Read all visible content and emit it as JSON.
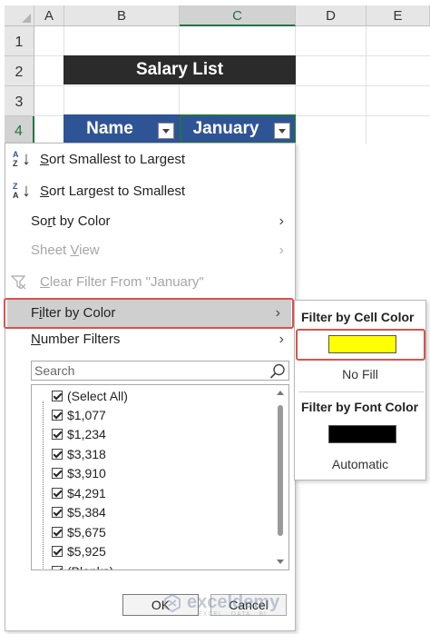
{
  "sheet": {
    "columns": [
      "A",
      "B",
      "C",
      "D",
      "E"
    ],
    "rows": [
      "1",
      "2",
      "3",
      "4"
    ],
    "title": "Salary List",
    "headers": [
      "Name",
      "January"
    ]
  },
  "menu": {
    "sort_asc": {
      "pre": "",
      "u": "S",
      "rest": "ort Smallest to Largest",
      "icon_top": "A",
      "icon_bottom": "Z"
    },
    "sort_desc": {
      "pre": "",
      "u": "S",
      "rest": "ort Largest to Smallest",
      "icon_top": "Z",
      "icon_bottom": "A"
    },
    "sort_by_color": {
      "pre": "So",
      "u": "r",
      "rest": "t by Color"
    },
    "sheet_view": {
      "pre": "Sheet ",
      "u": "V",
      "rest": "iew"
    },
    "clear_filter": {
      "pre": "",
      "u": "C",
      "rest": "lear Filter From \"January\""
    },
    "filter_by_color": {
      "pre": "F",
      "u": "i",
      "rest": "lter by Color"
    },
    "number_filters": {
      "pre": "",
      "u": "N",
      "rest": "umber Filters"
    },
    "arrow": "›",
    "search_placeholder": "Search",
    "list_items": [
      "(Select All)",
      "$1,077",
      "$1,234",
      "$3,318",
      "$3,910",
      "$4,291",
      "$5,384",
      "$5,675",
      "$5,925",
      "(Blanks)"
    ],
    "ok": "OK",
    "cancel": "Cancel"
  },
  "submenu": {
    "cell_color_heading": "Filter by Cell Color",
    "no_fill": "No Fill",
    "font_color_heading": "Filter by Font Color",
    "automatic": "Automatic"
  },
  "colors": {
    "header_fill": "#2f5496",
    "title_fill": "#2b2b2b",
    "cell_swatch": "#ffff00",
    "font_swatch": "#000000",
    "highlight_box": "#d9534f",
    "excel_green": "#217346"
  },
  "watermark": {
    "name": "exceldemy",
    "sub": "EXCEL · DATA · BI"
  }
}
